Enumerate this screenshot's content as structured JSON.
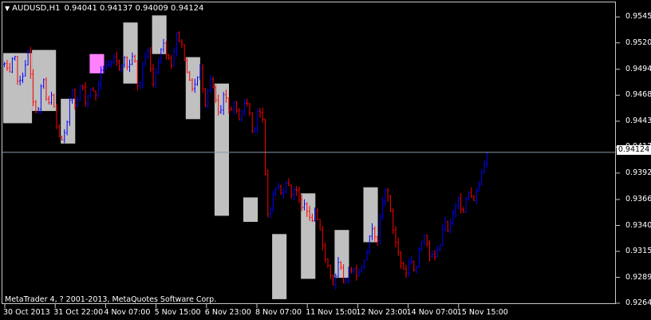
{
  "header": {
    "symbol": "AUDUSD,H1",
    "ohlc": "0.94041 0.94137 0.94009 0.94124"
  },
  "copyright": "MetaTrader 4, ? 2001-2013, MetaQuotes Software Corp.",
  "price_axis": [
    "0.95455",
    "0.95200",
    "0.94940",
    "0.94685",
    "0.94430",
    "0.94175",
    "0.93920",
    "0.93660",
    "0.93405",
    "0.93150",
    "0.92895",
    "0.92640"
  ],
  "current_price": "0.94124",
  "time_axis": [
    "30 Oct 2013",
    "31 Oct 22:00",
    "4 Nov 07:00",
    "5 Nov 15:00",
    "6 Nov 23:00",
    "8 Nov 07:00",
    "11 Nov 15:00",
    "12 Nov 23:00",
    "14 Nov 07:00",
    "15 Nov 15:00"
  ],
  "colors": {
    "background": "#000000",
    "bull_bar": "#0000ff",
    "bear_bar": "#ff0000",
    "session_box": "#c0c0c0",
    "highlight_box": "#ff80ff",
    "grid": "#c8c8c8",
    "current_line": "#8899aa"
  },
  "chart_data": {
    "type": "bar",
    "title": "AUDUSD,H1",
    "ylim": [
      0.9264,
      0.9559
    ],
    "current_price": 0.94124,
    "path": [
      0.9499,
      0.9487,
      0.951,
      0.9476,
      0.9493,
      0.9512,
      0.946,
      0.945,
      0.949,
      0.9455,
      0.947,
      0.9434,
      0.9423,
      0.9435,
      0.948,
      0.9455,
      0.9482,
      0.9462,
      0.9476,
      0.9467,
      0.9488,
      0.9501,
      0.9495,
      0.9505,
      0.9496,
      0.9505,
      0.9494,
      0.9513,
      0.947,
      0.95,
      0.9512,
      0.948,
      0.9497,
      0.9522,
      0.9509,
      0.9499,
      0.9528,
      0.952,
      0.9498,
      0.9475,
      0.948,
      0.9494,
      0.946,
      0.9486,
      0.9468,
      0.9445,
      0.947,
      0.9453,
      0.946,
      0.9445,
      0.9458,
      0.9462,
      0.9428,
      0.9455,
      0.9447,
      0.935,
      0.9365,
      0.9382,
      0.937,
      0.9385,
      0.9372,
      0.938,
      0.9356,
      0.9363,
      0.9344,
      0.9352,
      0.9336,
      0.9312,
      0.9296,
      0.928,
      0.9305,
      0.9285,
      0.9293,
      0.9302,
      0.929,
      0.9305,
      0.9318,
      0.934,
      0.9325,
      0.936,
      0.938,
      0.9345,
      0.9322,
      0.9303,
      0.9294,
      0.931,
      0.9292,
      0.932,
      0.9335,
      0.9312,
      0.9308,
      0.932,
      0.9345,
      0.9332,
      0.9355,
      0.937,
      0.935,
      0.9375,
      0.9364,
      0.9375,
      0.9395,
      0.9413
    ],
    "session_boxes": [
      {
        "x_from": 0,
        "x_to": 5,
        "low": 0.9441,
        "high": 0.951
      },
      {
        "x_from": 6,
        "x_to": 10,
        "low": 0.9453,
        "high": 0.9513
      },
      {
        "x_from": 12,
        "x_to": 14,
        "low": 0.9421,
        "high": 0.9465
      },
      {
        "x_from": 18,
        "x_to": 20,
        "low": 0.949,
        "high": 0.9509,
        "highlight": true
      },
      {
        "x_from": 25,
        "x_to": 27,
        "low": 0.948,
        "high": 0.954
      },
      {
        "x_from": 31,
        "x_to": 33,
        "low": 0.9509,
        "high": 0.9547
      },
      {
        "x_from": 38,
        "x_to": 40,
        "low": 0.9445,
        "high": 0.9506
      },
      {
        "x_from": 44,
        "x_to": 46,
        "low": 0.935,
        "high": 0.948
      },
      {
        "x_from": 50,
        "x_to": 52,
        "low": 0.9344,
        "high": 0.9368
      },
      {
        "x_from": 56,
        "x_to": 58,
        "low": 0.9268,
        "high": 0.9332
      },
      {
        "x_from": 62,
        "x_to": 64,
        "low": 0.9288,
        "high": 0.9372
      },
      {
        "x_from": 69,
        "x_to": 71,
        "low": 0.9289,
        "high": 0.9336
      },
      {
        "x_from": 75,
        "x_to": 77,
        "low": 0.9324,
        "high": 0.9378
      }
    ]
  }
}
